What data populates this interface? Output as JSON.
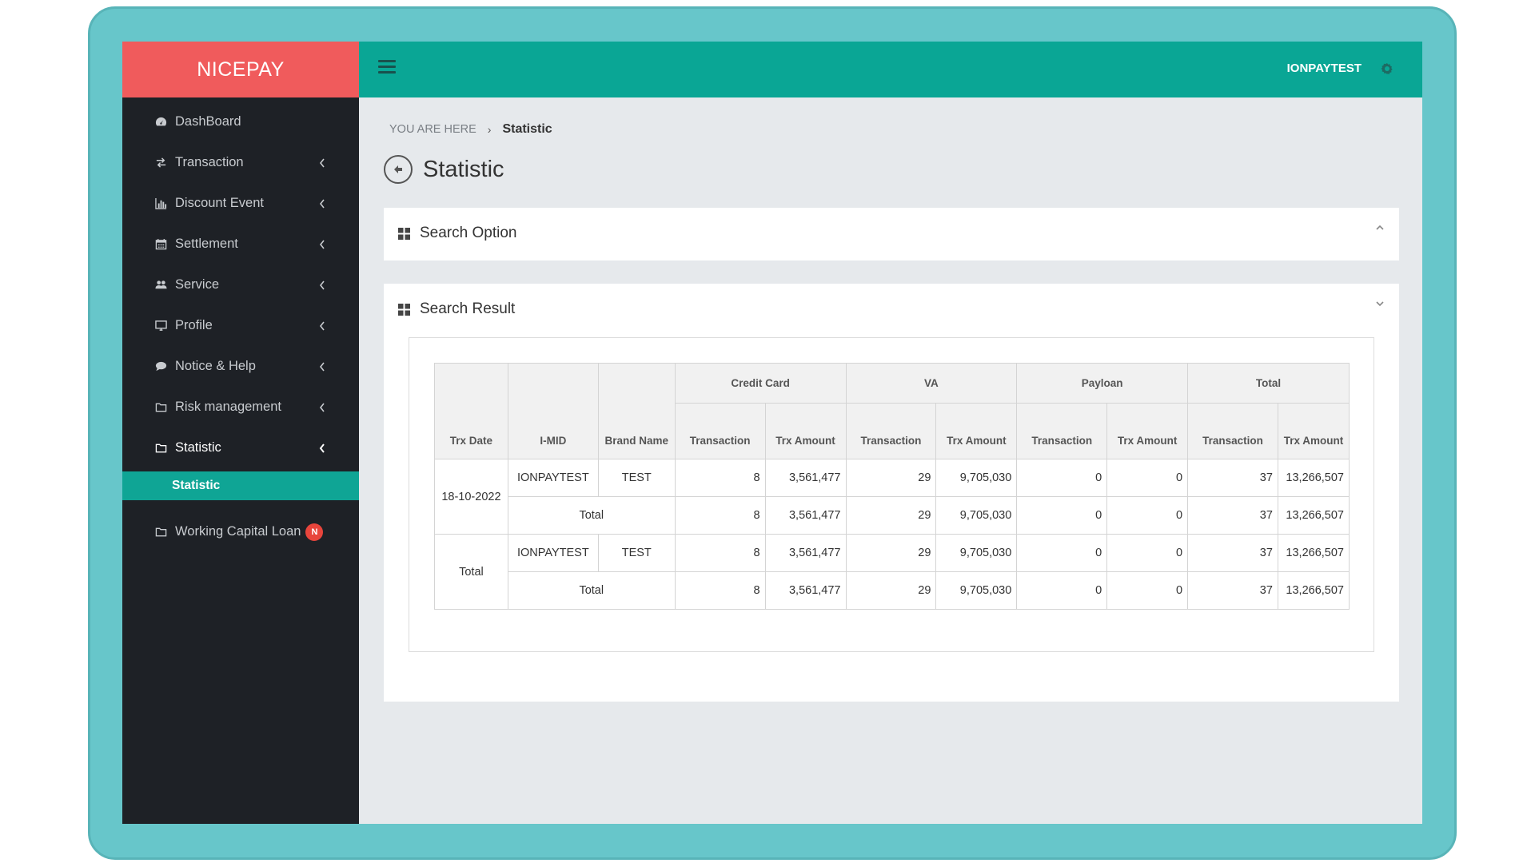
{
  "brand": "NICEPAY",
  "sidebar": {
    "items": [
      {
        "label": "DashBoard",
        "icon": "dashboard-icon"
      },
      {
        "label": "Transaction",
        "icon": "exchange-icon"
      },
      {
        "label": "Discount Event",
        "icon": "bar-chart-icon"
      },
      {
        "label": "Settlement",
        "icon": "calendar-icon"
      },
      {
        "label": "Service",
        "icon": "users-icon"
      },
      {
        "label": "Profile",
        "icon": "monitor-icon"
      },
      {
        "label": "Notice & Help",
        "icon": "comment-icon"
      },
      {
        "label": "Risk management",
        "icon": "folder-icon"
      },
      {
        "label": "Statistic",
        "icon": "folder-icon"
      },
      {
        "label": "Working Capital Loan",
        "icon": "folder-icon",
        "badge": "N"
      }
    ],
    "sub_item": "Statistic"
  },
  "header": {
    "user": "IONPAYTEST"
  },
  "breadcrumb": {
    "prefix": "YOU ARE HERE",
    "separator": "›",
    "current": "Statistic"
  },
  "page_title": "Statistic",
  "search_panel": {
    "title": "Search Option"
  },
  "result_panel": {
    "title": "Search Result"
  },
  "table": {
    "col_headers": {
      "trx_date": "Trx Date",
      "imid": "I-MID",
      "brand_name": "Brand Name",
      "groups": [
        "Credit Card",
        "VA",
        "Payloan",
        "Total"
      ],
      "transaction": "Transaction",
      "trx_amount": "Trx Amount"
    },
    "rows": [
      {
        "date": "18-10-2022",
        "imid": "IONPAYTEST",
        "brand": "TEST",
        "vals": [
          "8",
          "3,561,477",
          "29",
          "9,705,030",
          "0",
          "0",
          "37",
          "13,266,507"
        ]
      },
      {
        "total_label": "Total",
        "vals": [
          "8",
          "3,561,477",
          "29",
          "9,705,030",
          "0",
          "0",
          "37",
          "13,266,507"
        ]
      },
      {
        "date": "Total",
        "imid": "IONPAYTEST",
        "brand": "TEST",
        "vals": [
          "8",
          "3,561,477",
          "29",
          "9,705,030",
          "0",
          "0",
          "37",
          "13,266,507"
        ]
      },
      {
        "total_label": "Total",
        "vals": [
          "8",
          "3,561,477",
          "29",
          "9,705,030",
          "0",
          "0",
          "37",
          "13,266,507"
        ]
      }
    ]
  },
  "colors": {
    "brand": "#f05b5c",
    "accent": "#0aa695",
    "sidebar": "#1e2126",
    "frame": "#67c6ca",
    "badge": "#e8453c"
  }
}
